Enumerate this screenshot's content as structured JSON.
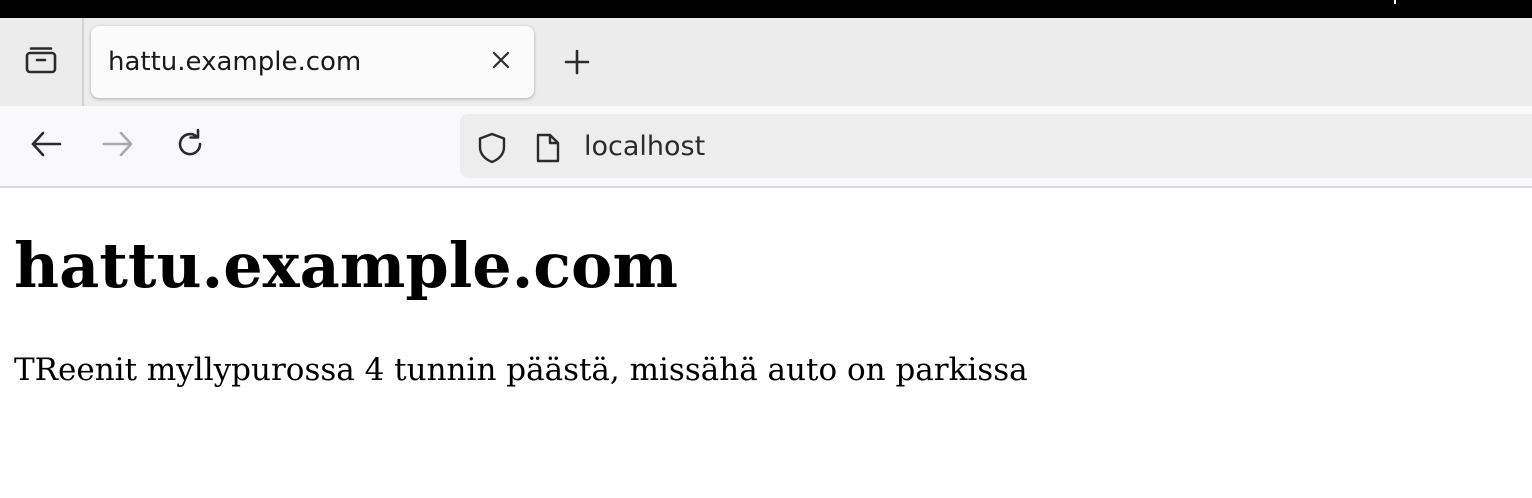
{
  "tab_strip": {
    "list_all_tabs_icon": "tabs-list-icon",
    "active_tab": {
      "title": "hattu.example.com",
      "close_icon": "close-icon"
    },
    "new_tab_icon": "plus-icon"
  },
  "nav_bar": {
    "back_icon": "arrow-left-icon",
    "forward_icon": "arrow-right-icon",
    "forward_enabled": false,
    "reload_icon": "reload-icon",
    "url_bar": {
      "shield_icon": "shield-icon",
      "page_icon": "page-icon",
      "url": "localhost"
    }
  },
  "page": {
    "heading": "hattu.example.com",
    "paragraph": "TReenit myllypurossa 4 tunnin päästä, missähä auto on parkissa"
  },
  "colors": {
    "tab_strip_bg": "#ececec",
    "active_tab_bg": "#fbfbfb",
    "nav_bar_bg": "#f9f9fb",
    "url_bar_bg": "#ededed",
    "disabled_icon": "#a8a8ad",
    "icon": "#2b2b2b"
  }
}
